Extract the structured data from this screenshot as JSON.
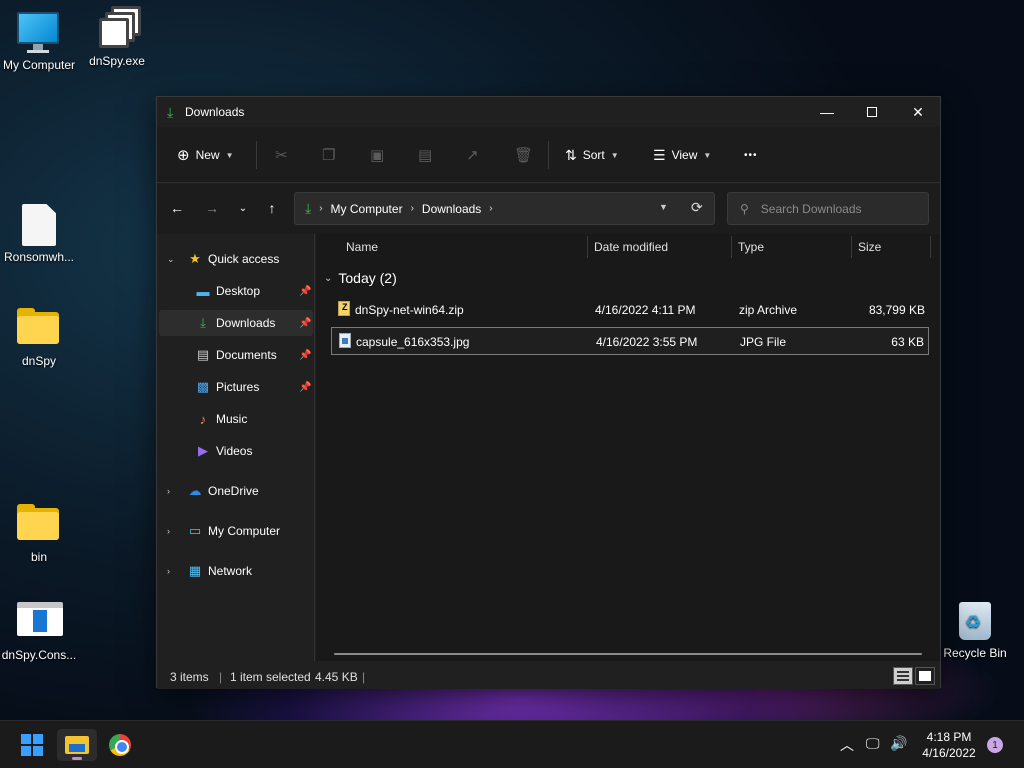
{
  "desktop": {
    "icons": [
      {
        "label": "My Computer"
      },
      {
        "label": "dnSpy.exe"
      },
      {
        "label": "Ronsomwh..."
      },
      {
        "label": "dnSpy"
      },
      {
        "label": "bin"
      },
      {
        "label": "dnSpy.Cons..."
      },
      {
        "label": "Recycle Bin"
      }
    ]
  },
  "window": {
    "title": "Downloads",
    "toolbar": {
      "new_label": "New",
      "sort_label": "Sort",
      "view_label": "View",
      "more_label": "•••"
    },
    "address": {
      "crumbs": [
        "My Computer",
        "Downloads"
      ]
    },
    "search": {
      "placeholder": "Search Downloads"
    },
    "nav": {
      "quick_access": "Quick access",
      "items": [
        {
          "label": "Desktop"
        },
        {
          "label": "Downloads"
        },
        {
          "label": "Documents"
        },
        {
          "label": "Pictures"
        },
        {
          "label": "Music"
        },
        {
          "label": "Videos"
        }
      ],
      "onedrive": "OneDrive",
      "my_computer": "My Computer",
      "network": "Network"
    },
    "columns": {
      "name": "Name",
      "date": "Date modified",
      "type": "Type",
      "size": "Size"
    },
    "group": {
      "label": "Today (2)"
    },
    "files": [
      {
        "name": "dnSpy-net-win64.zip",
        "date": "4/16/2022 4:11 PM",
        "type": "zip Archive",
        "size": "83,799 KB"
      },
      {
        "name": "capsule_616x353.jpg",
        "date": "4/16/2022 3:55 PM",
        "type": "JPG File",
        "size": "63 KB"
      }
    ],
    "status": {
      "items": "3 items",
      "selected": "1 item selected",
      "size": "4.45 KB"
    }
  },
  "taskbar": {
    "time": "4:18 PM",
    "date": "4/16/2022",
    "notifications": "1"
  }
}
